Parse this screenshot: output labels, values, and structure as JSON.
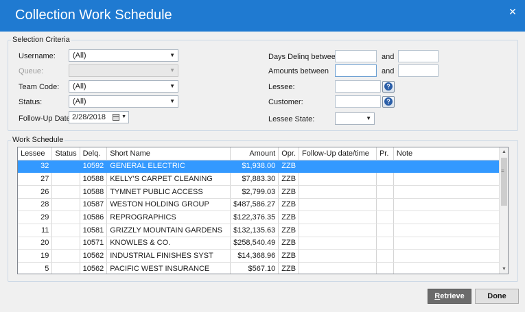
{
  "window": {
    "title": "Collection Work Schedule",
    "close_glyph": "✕"
  },
  "selection": {
    "legend": "Selection Criteria",
    "username": {
      "label": "Username:",
      "value": "(All)"
    },
    "queue": {
      "label": "Queue:",
      "value": ""
    },
    "team_code": {
      "label": "Team Code:",
      "value": "(All)"
    },
    "status": {
      "label": "Status:",
      "value": "(All)"
    },
    "followup_date": {
      "label": "Follow-Up Date:",
      "value": "2/28/2018"
    },
    "days_delinq": {
      "label": "Days Delinq between",
      "and": "and"
    },
    "amounts": {
      "label": "Amounts between",
      "and": "and"
    },
    "lessee": {
      "label": "Lessee:"
    },
    "customer": {
      "label": "Customer:"
    },
    "lessee_state": {
      "label": "Lessee State:",
      "value": ""
    },
    "help_glyph": "?"
  },
  "work": {
    "legend": "Work Schedule",
    "columns": [
      "Lessee",
      "Status",
      "Delq.",
      "Short Name",
      "Amount",
      "Opr.",
      "Follow-Up date/time",
      "Pr.",
      "Note"
    ],
    "rows": [
      {
        "lessee": "32",
        "status": "",
        "delq": "10592",
        "name": "GENERAL ELECTRIC",
        "amount": "$1,938.00",
        "opr": "ZZB",
        "followup": "",
        "pr": "",
        "note": ""
      },
      {
        "lessee": "27",
        "status": "",
        "delq": "10588",
        "name": "KELLY'S CARPET CLEANING",
        "amount": "$7,883.30",
        "opr": "ZZB",
        "followup": "",
        "pr": "",
        "note": ""
      },
      {
        "lessee": "26",
        "status": "",
        "delq": "10588",
        "name": "TYMNET PUBLIC ACCESS",
        "amount": "$2,799.03",
        "opr": "ZZB",
        "followup": "",
        "pr": "",
        "note": ""
      },
      {
        "lessee": "28",
        "status": "",
        "delq": "10587",
        "name": "WESTON HOLDING GROUP",
        "amount": "$487,586.27",
        "opr": "ZZB",
        "followup": "",
        "pr": "",
        "note": ""
      },
      {
        "lessee": "29",
        "status": "",
        "delq": "10586",
        "name": "REPROGRAPHICS",
        "amount": "$122,376.35",
        "opr": "ZZB",
        "followup": "",
        "pr": "",
        "note": ""
      },
      {
        "lessee": "11",
        "status": "",
        "delq": "10581",
        "name": "GRIZZLY MOUNTAIN GARDENS",
        "amount": "$132,135.63",
        "opr": "ZZB",
        "followup": "",
        "pr": "",
        "note": ""
      },
      {
        "lessee": "20",
        "status": "",
        "delq": "10571",
        "name": "KNOWLES & CO.",
        "amount": "$258,540.49",
        "opr": "ZZB",
        "followup": "",
        "pr": "",
        "note": ""
      },
      {
        "lessee": "19",
        "status": "",
        "delq": "10562",
        "name": "INDUSTRIAL FINISHES SYST",
        "amount": "$14,368.96",
        "opr": "ZZB",
        "followup": "",
        "pr": "",
        "note": ""
      },
      {
        "lessee": "5",
        "status": "",
        "delq": "10562",
        "name": "PACIFIC WEST INSURANCE",
        "amount": "$567.10",
        "opr": "ZZB",
        "followup": "",
        "pr": "",
        "note": ""
      }
    ],
    "selected_row": 0
  },
  "buttons": {
    "retrieve_first": "R",
    "retrieve_rest": "etrieve",
    "done": "Done"
  },
  "colors": {
    "titlebar": "#1f7ad1",
    "selection": "#3399ff",
    "primary_button": "#6b6b6b"
  }
}
